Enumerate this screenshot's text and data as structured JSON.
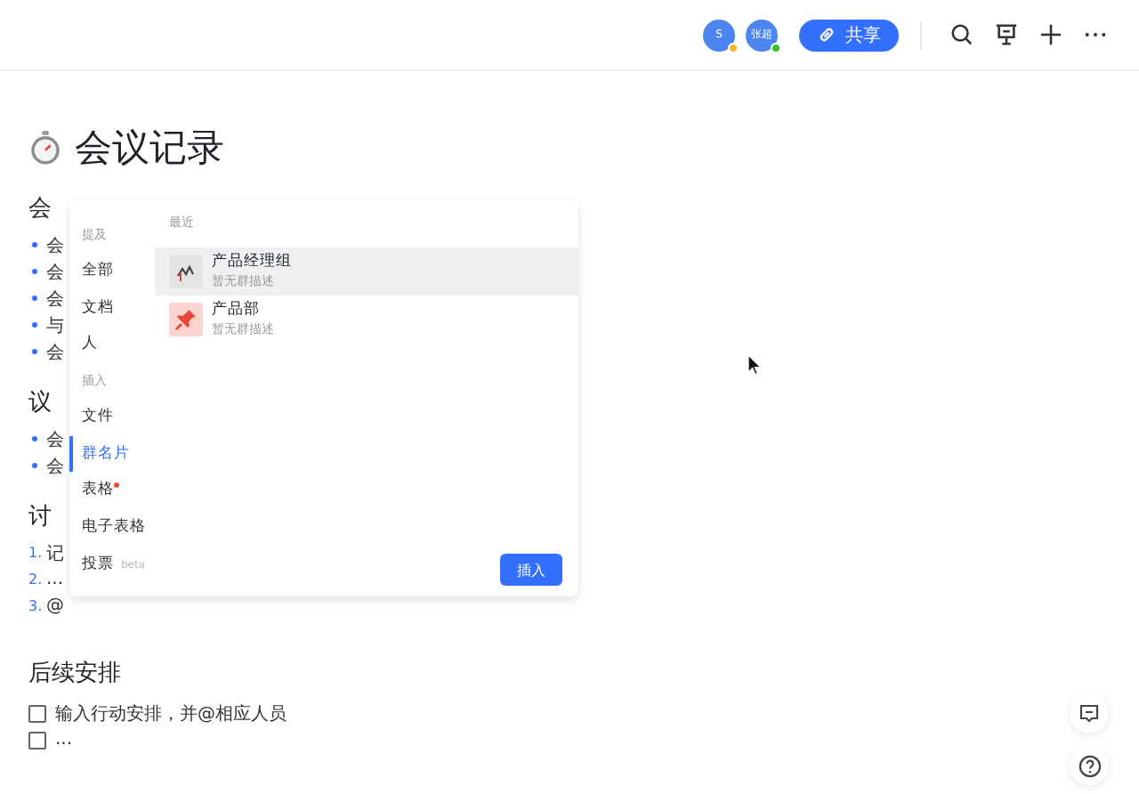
{
  "topbar": {
    "avatars": [
      {
        "initials": "S",
        "color": "#f5b82e"
      },
      {
        "initials": "张超",
        "color": "#34c724"
      }
    ],
    "share_button": "共享"
  },
  "document": {
    "title": "会议记录",
    "sections": [
      {
        "heading": "会",
        "items": [
          {
            "kind": "bullet",
            "text": "会"
          },
          {
            "kind": "bullet",
            "text": "会"
          },
          {
            "kind": "bullet",
            "text": "会"
          },
          {
            "kind": "bullet",
            "text": "与"
          },
          {
            "kind": "bullet",
            "text": "会"
          }
        ]
      },
      {
        "heading": "议",
        "items": [
          {
            "kind": "bullet",
            "text": "会"
          },
          {
            "kind": "bullet",
            "text": "会"
          }
        ]
      },
      {
        "heading": "讨",
        "items": [
          {
            "kind": "number",
            "marker": "1.",
            "text": "记"
          },
          {
            "kind": "number",
            "marker": "2.",
            "text": "..."
          },
          {
            "kind": "number",
            "marker": "3.",
            "text": "@"
          }
        ]
      },
      {
        "heading": "后续安排",
        "items": [
          {
            "kind": "todo",
            "text": "输入行动安排，并@相应人员",
            "checked": false
          },
          {
            "kind": "todo",
            "text": "...",
            "checked": false
          }
        ]
      }
    ]
  },
  "insert_popup": {
    "categories": [
      {
        "kind": "header",
        "label": "提及"
      },
      {
        "kind": "item",
        "label": "全部",
        "selected": false,
        "new": false
      },
      {
        "kind": "item",
        "label": "文档",
        "selected": false,
        "new": false
      },
      {
        "kind": "item",
        "label": "人",
        "selected": false,
        "new": false
      },
      {
        "kind": "header",
        "label": "插入"
      },
      {
        "kind": "item",
        "label": "文件",
        "selected": false,
        "new": false
      },
      {
        "kind": "item",
        "label": "群名片",
        "selected": true,
        "new": false
      },
      {
        "kind": "item",
        "label": "表格",
        "selected": false,
        "new": true
      },
      {
        "kind": "item",
        "label": "电子表格",
        "selected": false,
        "new": false
      },
      {
        "kind": "item",
        "label": "投票",
        "tag": "beta",
        "selected": false,
        "new": false
      }
    ],
    "recent_label": "最近",
    "results": [
      {
        "kind": "chart",
        "name": "产品经理组",
        "description": "暂无群描述",
        "selected": true
      },
      {
        "kind": "pin",
        "name": "产品部",
        "description": "暂无群描述",
        "selected": false
      }
    ],
    "insert_button": "插入"
  }
}
